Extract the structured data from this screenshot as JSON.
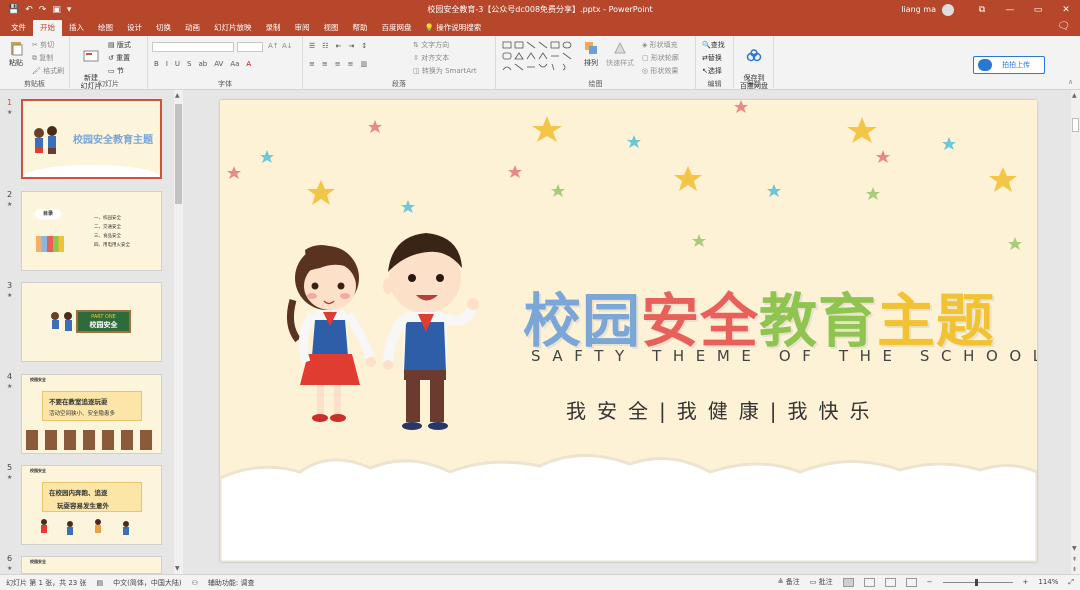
{
  "window": {
    "title": "校园安全教育-3【公众号dc008免费分享】.pptx  -  PowerPoint",
    "user": "liang ma",
    "min": "—",
    "restore": "▭",
    "close": "✕",
    "ribbon_toggle": "⧉"
  },
  "tabs": [
    "文件",
    "开始",
    "插入",
    "绘图",
    "设计",
    "切换",
    "动画",
    "幻灯片放映",
    "录制",
    "审阅",
    "视图",
    "帮助",
    "百度网盘"
  ],
  "active_tab": 1,
  "tell_me": "操作说明搜索",
  "ribbon": {
    "clipboard": {
      "label": "剪贴板",
      "paste": "粘贴",
      "cut": "剪切",
      "copy": "复制",
      "format_painter": "格式刷"
    },
    "slides": {
      "label": "幻灯片",
      "new_slide": "新建\n幻灯片",
      "layout": "版式",
      "reset": "重置",
      "section": "节"
    },
    "font": {
      "label": "字体",
      "buttons": [
        "B",
        "I",
        "U",
        "S",
        "ab",
        "AV",
        "Aa",
        "A"
      ]
    },
    "paragraph": {
      "label": "段落",
      "text_direction": "文字方向",
      "align_text": "对齐文本",
      "smartart": "转换为 SmartArt"
    },
    "drawing": {
      "label": "绘图",
      "arrange": "排列",
      "quick_styles": "快速样式",
      "shape_fill": "形状填充",
      "shape_outline": "形状轮廓",
      "shape_effects": "形状效果"
    },
    "editing": {
      "label": "编辑",
      "find": "查找",
      "replace": "替换",
      "select": "选择"
    },
    "save": {
      "label": "保存",
      "save_to": "保存到\n百度网盘"
    },
    "upload": "拍拍上传"
  },
  "thumbnails": [
    {
      "num": "1",
      "title": "校园安全教育主题"
    },
    {
      "num": "2",
      "menu_title": "目录",
      "items": [
        "一、校园安全",
        "二、交通安全",
        "三、食品安全",
        "四、用电用火安全"
      ]
    },
    {
      "num": "3",
      "part": "PART ONE",
      "label": "校园安全"
    },
    {
      "num": "4",
      "header": "校园安全",
      "text": "不要在教室追逐玩耍",
      "subtext": "活动空间狭小、安全隐患多"
    },
    {
      "num": "5",
      "header": "校园安全",
      "text": "在校园内奔跑、追逐",
      "subtext": "玩耍容易发生意外"
    },
    {
      "num": "6",
      "header": "校园安全"
    }
  ],
  "slide": {
    "title_parts": [
      {
        "text": "校园",
        "color": "#7aa6d8"
      },
      {
        "text": "安全",
        "color": "#e8605a"
      },
      {
        "text": "教育",
        "color": "#8ec44f"
      },
      {
        "text": "主题",
        "color": "#f1c232"
      }
    ],
    "subtitle": "SAFTY THEME OF THE SCHOOL",
    "tagline": "我安全|我健康|我快乐"
  },
  "status": {
    "slide_info": "幻灯片 第 1 张，共 23 张",
    "language": "中文(简体，中国大陆)",
    "accessibility": "辅助功能: 调查",
    "notes": "备注",
    "comments": "批注",
    "zoom": "114%"
  }
}
